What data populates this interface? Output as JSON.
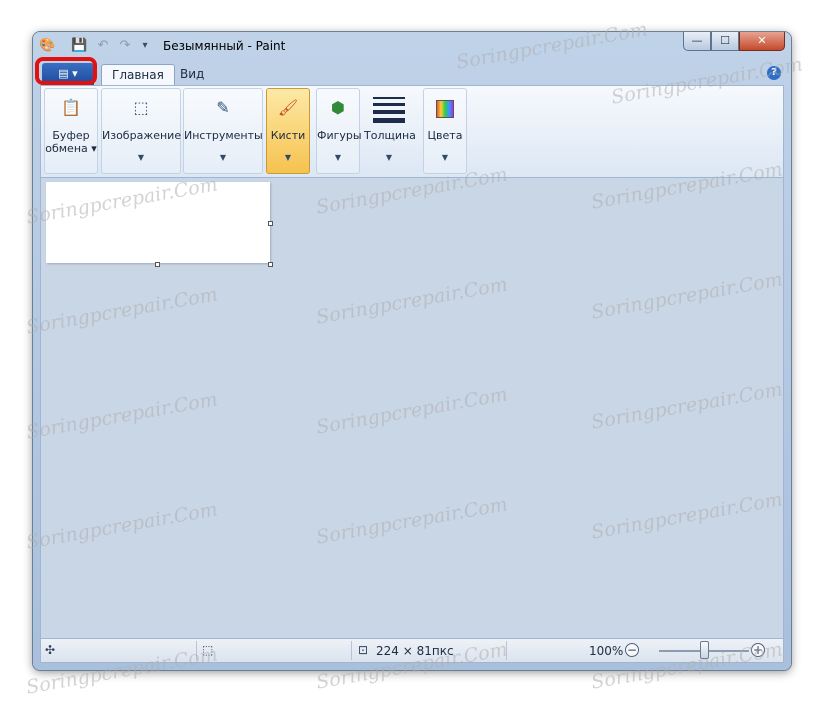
{
  "window": {
    "title": "Безымянный - Paint",
    "qat_icons": [
      "paint-logo-icon",
      "save-icon",
      "undo-icon",
      "redo-icon",
      "customize-qat-icon"
    ],
    "caption": {
      "minimize": "—",
      "maximize": "☐",
      "close": "✕"
    }
  },
  "tabs": {
    "app_menu_icon": "▤ ▾",
    "main": "Главная",
    "view": "Вид",
    "help": "?"
  },
  "ribbon": {
    "groups": [
      {
        "label1": "Буфер",
        "label2": "обмена ▾",
        "icon": "clipboard-icon"
      },
      {
        "label1": "Изображение",
        "label2": "",
        "icon": "select-icon"
      },
      {
        "label1": "Инструменты",
        "label2": "",
        "icon": "tools-icon"
      },
      {
        "label1": "Кисти",
        "label2": "",
        "icon": "brush-icon"
      },
      {
        "label1": "Фигуры",
        "label2": "",
        "icon": "shapes-icon"
      },
      {
        "label1": "Толщина",
        "label2": "",
        "icon": "thickness-icon"
      },
      {
        "label1": "Цвета",
        "label2": "",
        "icon": "colors-icon"
      }
    ],
    "dropdown_glyph": "▼"
  },
  "statusbar": {
    "size_text": "224 × 81пкс",
    "zoom_text": "100%",
    "zoom_level": 0.5,
    "zoom_out": "−",
    "zoom_in": "+"
  },
  "watermark": "Soringpcrepair.Com"
}
